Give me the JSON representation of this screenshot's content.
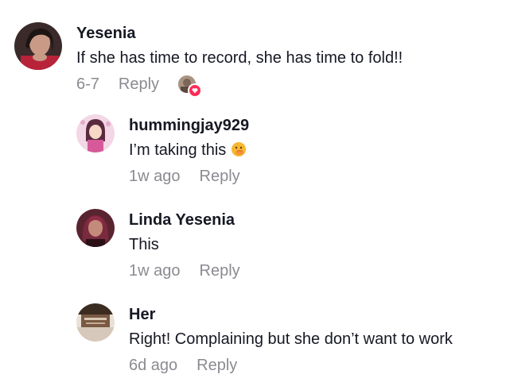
{
  "comments": [
    {
      "username": "Yesenia",
      "text": "If she has time to record, she has time to fold!!",
      "date": "6-7",
      "reply_label": "Reply",
      "liked_by_creator": true
    },
    {
      "username": "hummingjay929",
      "text": "I’m taking this",
      "emoji": "hand-over-mouth-emoji",
      "date": "1w ago",
      "reply_label": "Reply"
    },
    {
      "username": "Linda Yesenia",
      "text": "This",
      "date": "1w ago",
      "reply_label": "Reply"
    },
    {
      "username": "Her",
      "text": "Right! Complaining but she don’t want to work",
      "date": "6d ago",
      "reply_label": "Reply"
    }
  ],
  "colors": {
    "primary_text": "#161823",
    "secondary_text": "#8a8b91",
    "like_badge": "#fe2c55"
  }
}
